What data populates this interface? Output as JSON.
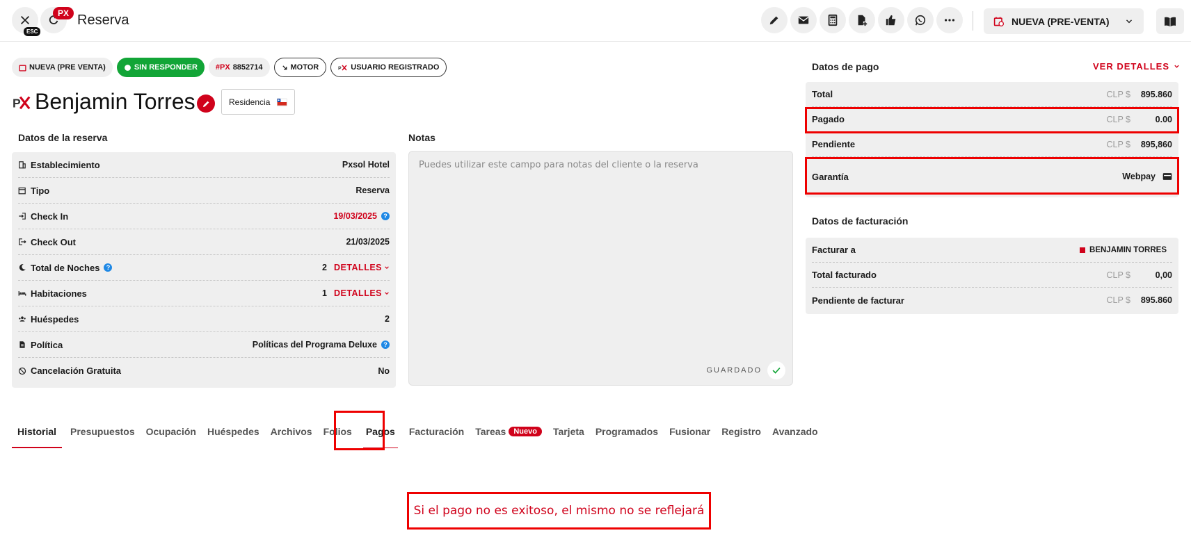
{
  "header": {
    "title": "Reserva",
    "esc_label": "ESC",
    "px_badge": "PX",
    "status_label": "NUEVA (PRE-VENTA)",
    "toolbar": [
      "pencil-icon",
      "mail-icon",
      "calculator-icon",
      "file-add-icon",
      "thumbs-up-icon",
      "whatsapp-icon",
      "more-icon"
    ]
  },
  "chips": {
    "status": "NUEVA (PRE VENTA)",
    "response": "SIN RESPONDER",
    "px_prefix": "#PX",
    "px_number": "8852714",
    "source": "MOTOR",
    "user": "USUARIO REGISTRADO"
  },
  "guest": {
    "logo": "PX",
    "name": "Benjamin Torres",
    "residencia_label": "Residencia"
  },
  "reserva": {
    "title": "Datos de la reserva",
    "establecimiento": {
      "label": "Establecimiento",
      "value": "Pxsol Hotel"
    },
    "tipo": {
      "label": "Tipo",
      "value": "Reserva"
    },
    "checkin": {
      "label": "Check In",
      "value": "19/03/2025"
    },
    "checkout": {
      "label": "Check Out",
      "value": "21/03/2025"
    },
    "noches": {
      "label": "Total de Noches",
      "value": "2",
      "link": "DETALLES"
    },
    "habitaciones": {
      "label": "Habitaciones",
      "value": "1",
      "link": "DETALLES"
    },
    "huespedes": {
      "label": "Huéspedes",
      "value": "2"
    },
    "politica": {
      "label": "Política",
      "value": "Políticas del Programa Deluxe"
    },
    "cancelacion": {
      "label": "Cancelación Gratuita",
      "value": "No"
    }
  },
  "notas": {
    "title": "Notas",
    "placeholder": "Puedes utilizar este campo para notas del cliente o la reserva",
    "saved_label": "GUARDADO"
  },
  "pago": {
    "title": "Datos de pago",
    "ver_detalles": "VER DETALLES",
    "total": {
      "label": "Total",
      "currency": "CLP $",
      "amount": "895.860"
    },
    "pagado": {
      "label": "Pagado",
      "currency": "CLP $",
      "amount": "0.00"
    },
    "pendiente": {
      "label": "Pendiente",
      "currency": "CLP $",
      "amount": "895,860"
    },
    "garantia": {
      "label": "Garantía",
      "value": "Webpay"
    }
  },
  "facturacion": {
    "title": "Datos de facturación",
    "facturar_a": {
      "label": "Facturar a",
      "value": "BENJAMIN TORRES"
    },
    "total_facturado": {
      "label": "Total facturado",
      "currency": "CLP $",
      "amount": "0,00"
    },
    "pendiente": {
      "label": "Pendiente de facturar",
      "currency": "CLP $",
      "amount": "895.860"
    }
  },
  "tabs": [
    "Historial",
    "Presupuestos",
    "Ocupación",
    "Huéspedes",
    "Archivos",
    "Folios",
    "Pagos",
    "Facturación",
    "Tareas",
    "Tarjeta",
    "Programados",
    "Fusionar",
    "Registro",
    "Avanzado"
  ],
  "tareas_badge": "Nuevo",
  "annotation": "Si el pago no es exitoso, el mismo no se reflejará",
  "colors": {
    "accent": "#d0021b",
    "success": "#12a537",
    "highlight": "#ee0000",
    "panel": "#efefef"
  }
}
